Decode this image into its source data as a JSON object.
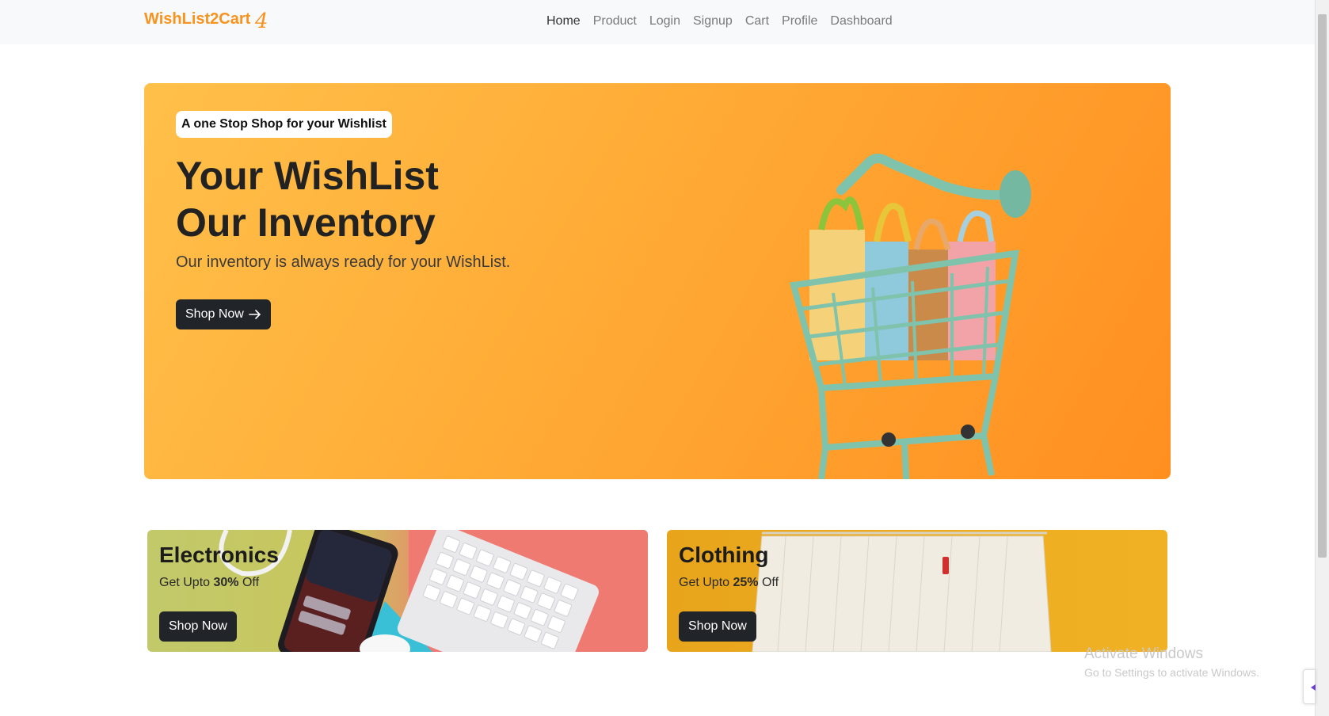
{
  "navbar": {
    "brand": "WishList2Cart",
    "brand_badge": "4",
    "links": [
      "Home",
      "Product",
      "Login",
      "Signup",
      "Cart",
      "Profile",
      "Dashboard"
    ],
    "active": "Home"
  },
  "hero": {
    "pill": "A one Stop Shop for your Wishlist",
    "title_line1": "Your WishList",
    "title_line2": "Our Inventory",
    "subtitle": "Our inventory is always ready for your WishList.",
    "button": "Shop Now",
    "button_icon": "arrow-right-icon"
  },
  "categories": [
    {
      "title": "Electronics",
      "sub_prefix": "Get Upto ",
      "discount": "30%",
      "sub_suffix": " Off",
      "button": "Shop Now"
    },
    {
      "title": "Clothing",
      "sub_prefix": "Get Upto ",
      "discount": "25%",
      "sub_suffix": " Off",
      "button": "Shop Now"
    }
  ],
  "watermark": {
    "title": "Activate Windows",
    "subtitle": "Go to Settings to activate Windows."
  },
  "colors": {
    "brand": "#f7931e",
    "hero_gradient_start": "#ffc04a",
    "hero_gradient_end": "#ff8f20",
    "button": "#212529",
    "cart": "#7fc3ad"
  }
}
